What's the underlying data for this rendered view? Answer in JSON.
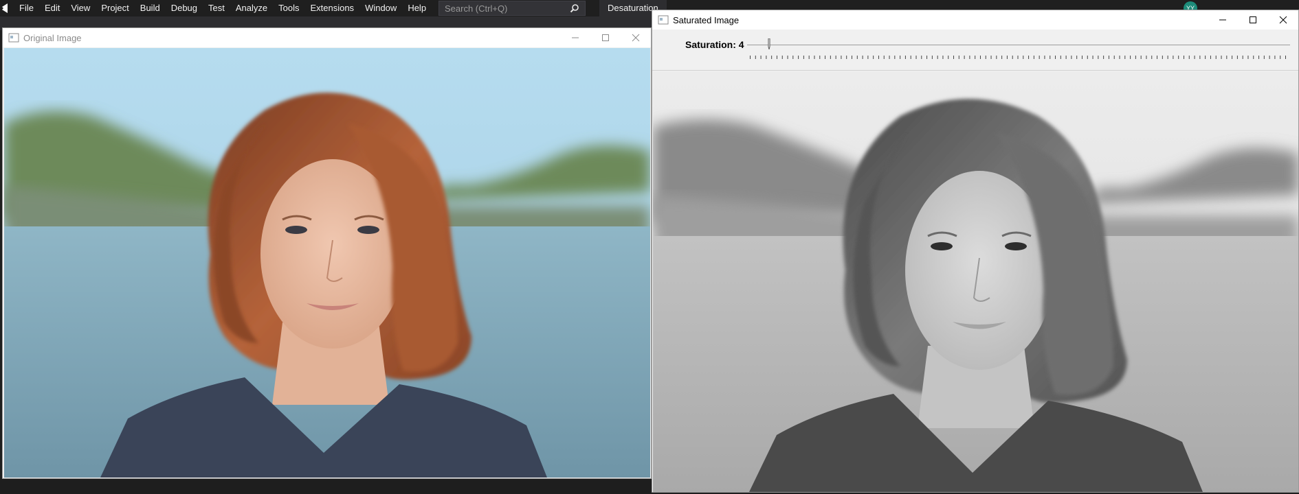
{
  "vs": {
    "menu": [
      "File",
      "Edit",
      "View",
      "Project",
      "Build",
      "Debug",
      "Test",
      "Analyze",
      "Tools",
      "Extensions",
      "Window",
      "Help"
    ],
    "search_placeholder": "Search (Ctrl+Q)",
    "solution_name": "Desaturation",
    "account_initials": "YY"
  },
  "windows": {
    "original": {
      "title": "Original Image"
    },
    "saturated": {
      "title": "Saturated Image",
      "trackbar_label": "Saturation: 4",
      "trackbar_value": 4,
      "trackbar_max": 100
    }
  },
  "colors": {
    "vs_menubar": "#1f1f1f",
    "sky_original": "#a9d1e8",
    "water_original": "#7fa6b8",
    "hair_original": "#a8552f",
    "sky_gray": "#e4e4e4",
    "water_gray": "#b8b8b8"
  }
}
